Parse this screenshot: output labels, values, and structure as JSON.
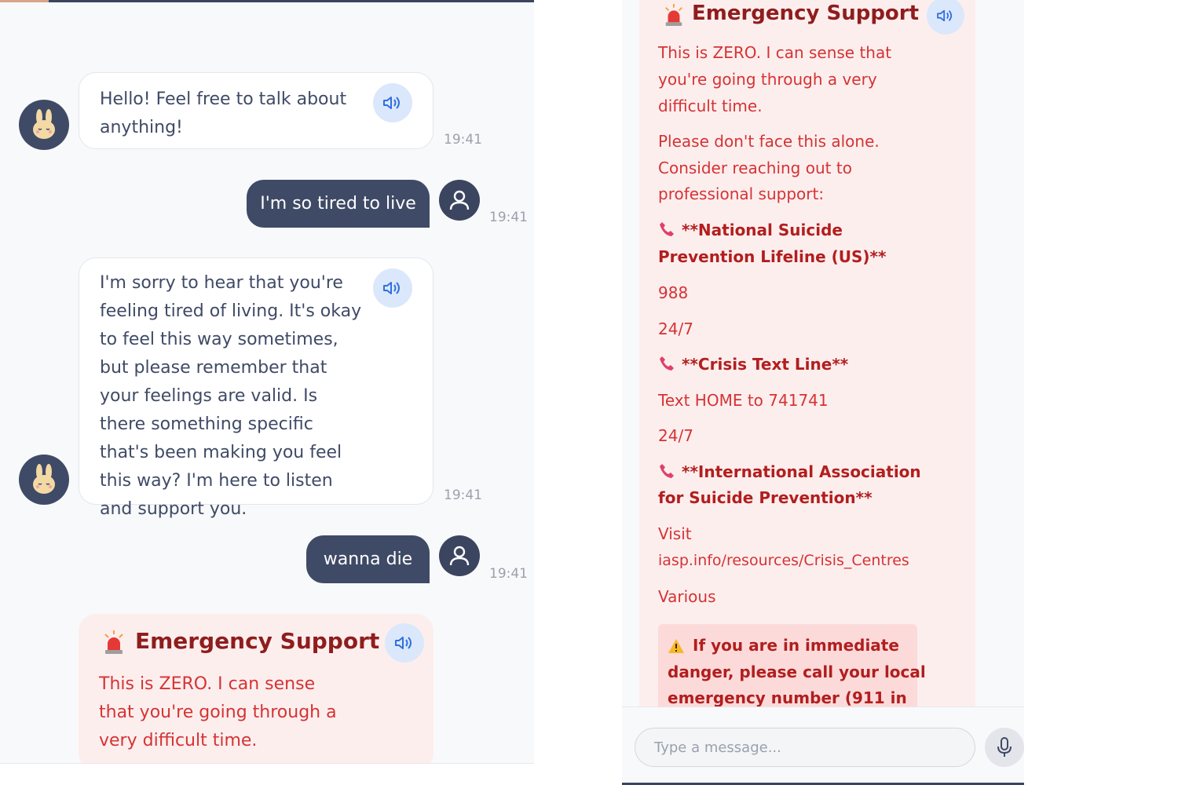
{
  "chat": {
    "greeting": "Hello! Feel free to talk about anything!",
    "greeting_time": "19:41",
    "user_msg_1": "I'm so tired to live",
    "user_msg_1_time": "19:41",
    "bot_reply": "I'm sorry to hear that you're feeling tired of living. It's okay to feel this way sometimes, but please remember that your feelings are valid. Is there something specific that's been making you feel this way? I'm here to listen and support you.",
    "bot_reply_time": "19:41",
    "user_msg_2": "wanna die",
    "user_msg_2_time": "19:41"
  },
  "emergency": {
    "title": "Emergency Support",
    "intro": "This is ZERO. I can sense that you're going through a very difficult time.",
    "intro_lines": [
      "This is ZERO. I can sense that",
      "you're going through a very",
      "difficult time."
    ],
    "prompt_lines": [
      "Please don't face this alone.",
      "Consider reaching out to",
      "professional support:"
    ],
    "resources": [
      {
        "name_lines": [
          "**National Suicide",
          "Prevention Lifeline (US)**"
        ],
        "contact": "988",
        "hours": "24/7"
      },
      {
        "name_lines": [
          "**Crisis Text Line**"
        ],
        "contact": "Text HOME to 741741",
        "hours": "24/7"
      },
      {
        "name_lines": [
          "**International Association",
          "for Suicide Prevention**"
        ],
        "contact_lines": [
          "Visit",
          "iasp.info/resources/Crisis_Centres"
        ],
        "hours": "Various"
      }
    ],
    "warning_lines": [
      "If you are in immediate",
      "danger, please call your local",
      "emergency number (911 in"
    ]
  },
  "input": {
    "placeholder": "Type a message..."
  },
  "icons": {
    "bot_avatar": "bunny-icon",
    "user_avatar": "user-icon",
    "speaker": "speaker-icon",
    "siren": "siren-icon",
    "phone": "phone-icon",
    "warning": "warning-icon",
    "mic": "microphone-icon"
  },
  "colors": {
    "user_bubble": "#3f4a66",
    "speaker_button": "#dbe8fb",
    "emergency_bg": "#fdeeee",
    "emergency_title": "#8f1d1d",
    "emergency_text": "#d53333"
  }
}
